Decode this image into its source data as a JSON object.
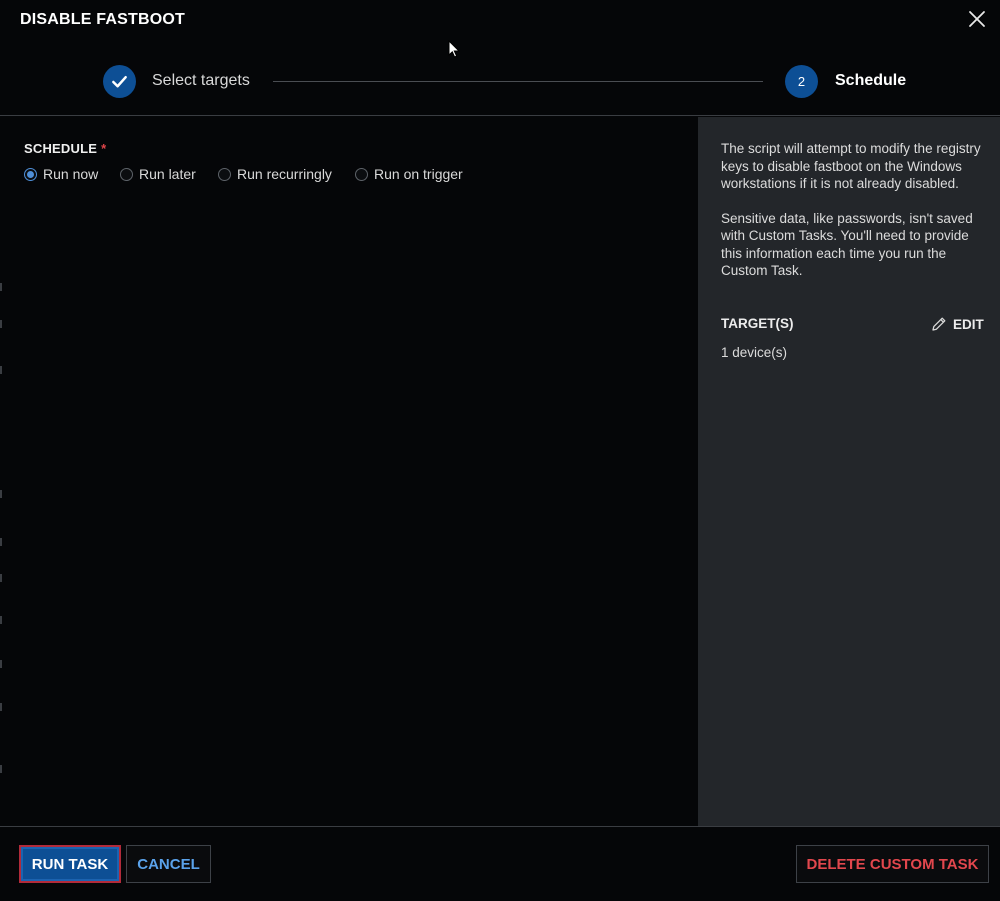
{
  "dialog": {
    "title": "DISABLE FASTBOOT",
    "close_icon": "close-icon"
  },
  "stepper": {
    "steps": [
      {
        "label": "Select targets",
        "state": "completed",
        "icon": "checkmark-icon"
      },
      {
        "number": "2",
        "label": "Schedule",
        "state": "active"
      }
    ]
  },
  "schedule": {
    "label": "SCHEDULE",
    "required_marker": "*",
    "options": [
      {
        "label": "Run now",
        "selected": true
      },
      {
        "label": "Run later",
        "selected": false
      },
      {
        "label": "Run recurringly",
        "selected": false
      },
      {
        "label": "Run on trigger",
        "selected": false
      }
    ]
  },
  "side_panel": {
    "description": "The script will attempt to modify the registry keys to disable fastboot on the Windows workstations if it is not already disabled.",
    "note": "Sensitive data, like passwords, isn't saved with Custom Tasks. You'll need to provide this information each time you run the Custom Task.",
    "targets_heading": "TARGET(S)",
    "edit_label": "EDIT",
    "edit_icon": "pencil-icon",
    "targets_value": "1 device(s)"
  },
  "footer": {
    "run_label": "RUN TASK",
    "cancel_label": "CANCEL",
    "delete_label": "DELETE CUSTOM TASK"
  },
  "colors": {
    "accent": "#0d4f95",
    "link": "#5aa2ea",
    "danger": "#e2474d",
    "panel": "#23262a",
    "background": "#050608"
  }
}
